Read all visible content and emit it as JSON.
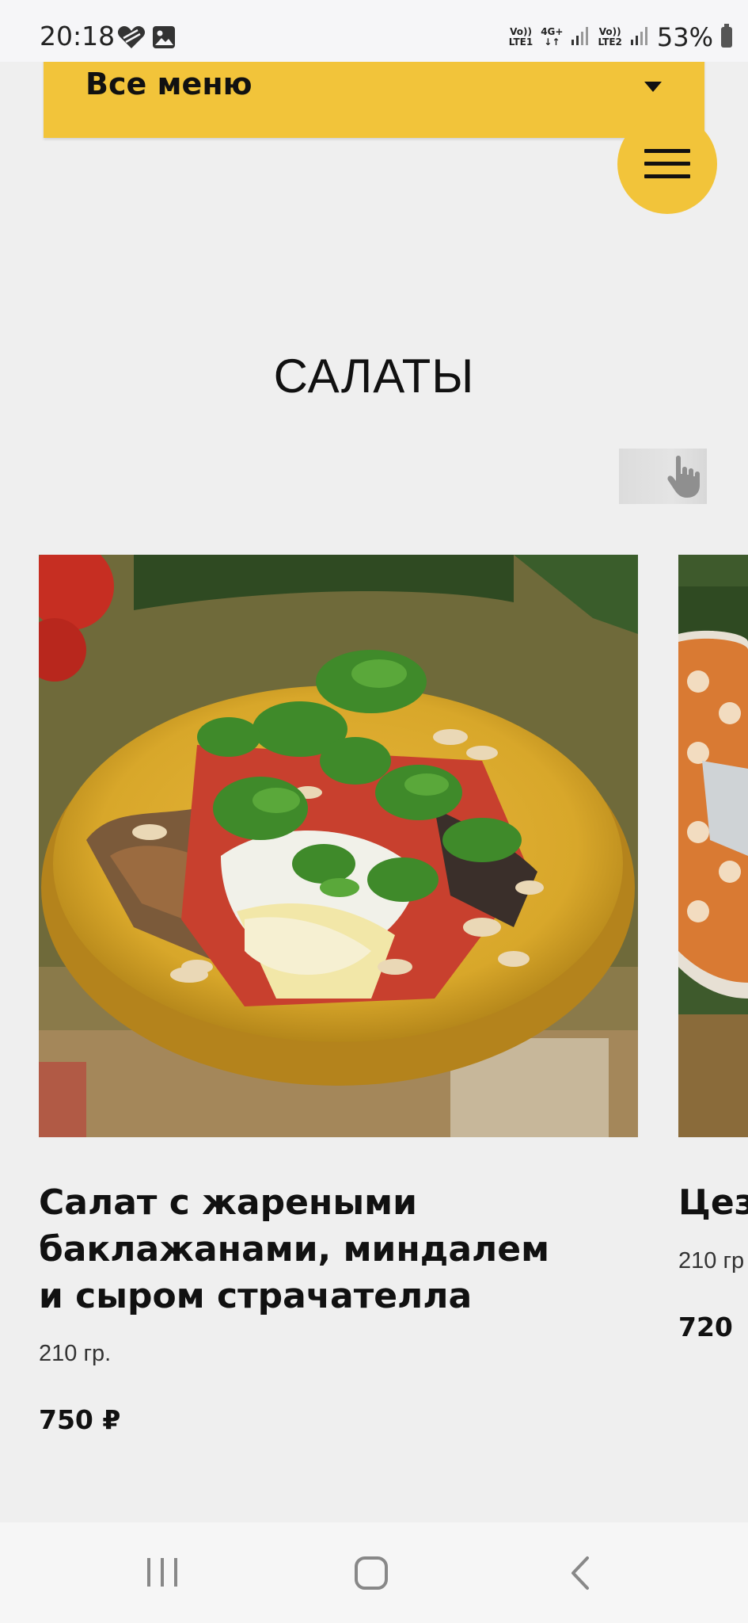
{
  "status_bar": {
    "time": "20:18",
    "left_icons": [
      "heart-badge-icon",
      "gallery-icon"
    ],
    "sim1": {
      "top": "Vo))",
      "bottom": "LTE1"
    },
    "net": {
      "top": "4G+",
      "bottom": "↓↑"
    },
    "sim2": {
      "top": "Vo))",
      "bottom": "LTE2"
    },
    "battery": "53%"
  },
  "menu": {
    "dropdown_label": "Все меню",
    "caret_icon": "caret-down-icon",
    "hamburger_icon": "hamburger-menu-icon",
    "accent_color": "#f2c43a"
  },
  "section": {
    "title": "САЛАТЫ",
    "swipe_hint_icon": "swipe-hand-icon"
  },
  "products": [
    {
      "name_lines": [
        "Салат с жареными",
        "баклажанами, миндалем",
        "и сыром страчателла"
      ],
      "weight": "210 гр.",
      "price": "750 ₽"
    },
    {
      "name_lines": [
        "Цез"
      ],
      "weight": "210 гр",
      "price": "720"
    }
  ],
  "nav": {
    "recents_icon": "recent-apps-icon",
    "home_icon": "home-icon",
    "back_icon": "back-icon"
  }
}
